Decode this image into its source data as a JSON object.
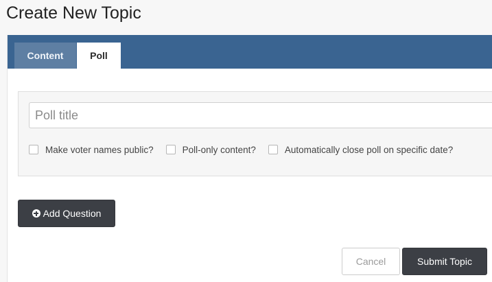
{
  "page": {
    "title": "Create New Topic"
  },
  "tabs": [
    {
      "label": "Content",
      "active": false
    },
    {
      "label": "Poll",
      "active": true
    }
  ],
  "poll": {
    "title_input": {
      "placeholder": "Poll title",
      "value": ""
    },
    "options": [
      {
        "label": "Make voter names public?",
        "checked": false
      },
      {
        "label": "Poll-only content?",
        "checked": false
      },
      {
        "label": "Automatically close poll on specific date?",
        "checked": false
      }
    ]
  },
  "buttons": {
    "add_question": "Add Question",
    "add_question_icon": "plus-circle-icon",
    "cancel": "Cancel",
    "submit": "Submit Topic"
  },
  "colors": {
    "tabbar": "#3a6491",
    "inactive_tab": "#5e7fa3",
    "dark_button": "#3c3f45"
  }
}
